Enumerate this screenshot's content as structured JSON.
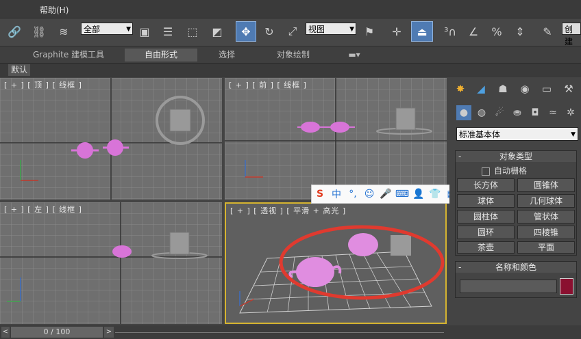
{
  "menubar": {
    "help": "帮助(H)"
  },
  "toolbar": {
    "selection_filter": "全部",
    "ref_coord": "视图",
    "named_set": "创建"
  },
  "ribbon": {
    "tabs": [
      "Graphite 建模工具",
      "自由形式",
      "选择",
      "对象绘制"
    ],
    "active_tab": "自由形式"
  },
  "subbar": {
    "tab": "默认"
  },
  "viewports": {
    "top": "[ + ] [ 顶 ] [ 线框 ]",
    "front": "[ + ] [ 前 ] [ 线框 ]",
    "left": "[ + ] [ 左 ] [ 线框 ]",
    "perspective": "[ + ] [ 透视 ] [ 平滑 + 高光 ]"
  },
  "command_panel": {
    "category": "标准基本体",
    "object_type_title": "对象类型",
    "autogrid": "自动栅格",
    "buttons": [
      "长方体",
      "圆锥体",
      "球体",
      "几何球体",
      "圆柱体",
      "管状体",
      "圆环",
      "四棱锥",
      "茶壶",
      "平面"
    ],
    "name_color_title": "名称和颜色",
    "object_color": "#8a1030"
  },
  "timeline": {
    "frame": "0 / 100"
  },
  "ime": {
    "labels": [
      "中",
      "°,"
    ]
  },
  "colors": {
    "teapot": "#d874d8",
    "highlight": "#e03a2f",
    "active_viewport": "#d6b430"
  }
}
